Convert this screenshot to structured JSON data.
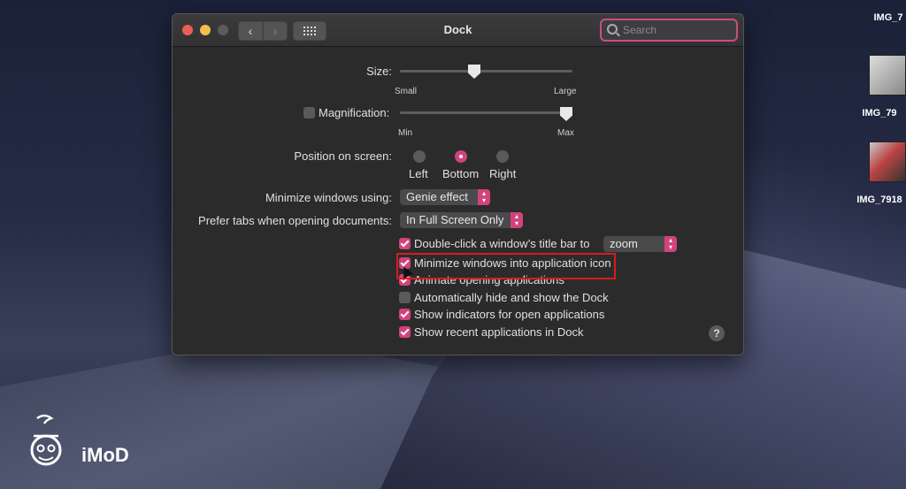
{
  "desktop": {
    "icons": [
      {
        "label": "IMG_7"
      },
      {
        "label": "IMG_79"
      },
      {
        "label": "IMG_7918"
      }
    ]
  },
  "window": {
    "title": "Dock",
    "search_placeholder": "Search"
  },
  "size": {
    "label": "Size:",
    "min_label": "Small",
    "max_label": "Large",
    "value": 0.5
  },
  "magnification": {
    "label": "Magnification:",
    "min_label": "Min",
    "max_label": "Max",
    "checked": false,
    "value": 1.0
  },
  "position": {
    "label": "Position on screen:",
    "options": [
      "Left",
      "Bottom",
      "Right"
    ],
    "selected": "Bottom"
  },
  "minimize_using": {
    "label": "Minimize windows using:",
    "value": "Genie effect"
  },
  "prefer_tabs": {
    "label": "Prefer tabs when opening documents:",
    "value": "In Full Screen Only"
  },
  "double_click": {
    "label": "Double-click a window’s title bar to",
    "value": "zoom",
    "checked": true
  },
  "checkboxes": [
    {
      "label": "Minimize windows into application icon",
      "checked": true
    },
    {
      "label": "Animate opening applications",
      "checked": true
    },
    {
      "label": "Automatically hide and show the Dock",
      "checked": false
    },
    {
      "label": "Show indicators for open applications",
      "checked": true
    },
    {
      "label": "Show recent applications in Dock",
      "checked": true
    }
  ],
  "help": "?",
  "watermark": "iMoD",
  "colors": {
    "accent": "#d2427c",
    "highlight_box": "#d61d1d"
  }
}
